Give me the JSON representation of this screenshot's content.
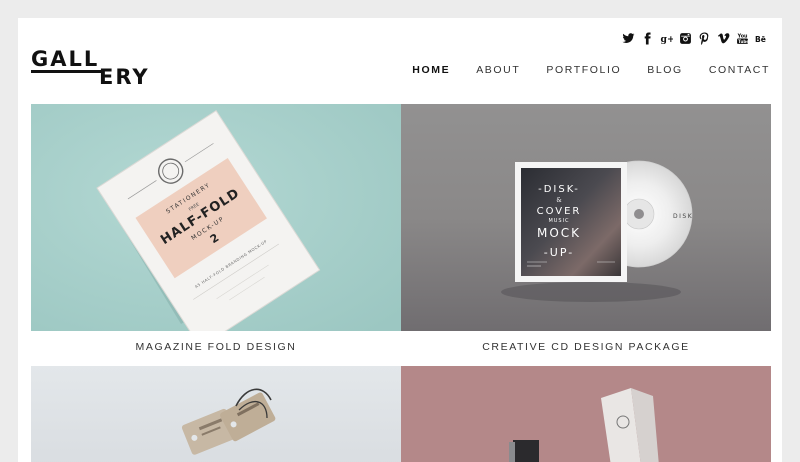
{
  "logo": {
    "line1": "GALL",
    "line2": "ERY"
  },
  "social": [
    {
      "name": "twitter-icon",
      "glyph": "🐦"
    },
    {
      "name": "facebook-icon",
      "glyph": "f"
    },
    {
      "name": "google-plus-icon",
      "glyph": "g+"
    },
    {
      "name": "instagram-icon",
      "glyph": "◙"
    },
    {
      "name": "pinterest-icon",
      "glyph": "P"
    },
    {
      "name": "vimeo-icon",
      "glyph": "V"
    },
    {
      "name": "youtube-icon",
      "glyph": "You"
    },
    {
      "name": "behance-icon",
      "glyph": "Bē"
    }
  ],
  "nav": {
    "home": "HOME",
    "about": "ABOUT",
    "portfolio": "PORTFOLIO",
    "blog": "BLOG",
    "contact": "CONTACT"
  },
  "gallery": {
    "item1": {
      "caption": "MAGAZINE FOLD DESIGN",
      "mock": {
        "top": "STATIONERY",
        "small": "FREE",
        "title": "HALF-FOLD",
        "sub": "MOCK-UP",
        "num": "2",
        "line": "A5 HALF-FOLD BRANDING MOCK-UP"
      }
    },
    "item2": {
      "caption": "CREATIVE CD DESIGN PACKAGE",
      "mock": {
        "disk": "-DISK-",
        "amp": "&",
        "cover": "COVER",
        "music": "MUSIC",
        "mock": "MOCK",
        "up": "-UP-",
        "label": "DISK"
      }
    },
    "item3": {
      "caption": ""
    },
    "item4": {
      "caption": ""
    }
  },
  "colors": {
    "page_bg": "#ececec",
    "tile1": "#a9d1cc",
    "tile2": "#8a8888",
    "tile3": "#dfe3e6",
    "tile4": "#b48889"
  }
}
